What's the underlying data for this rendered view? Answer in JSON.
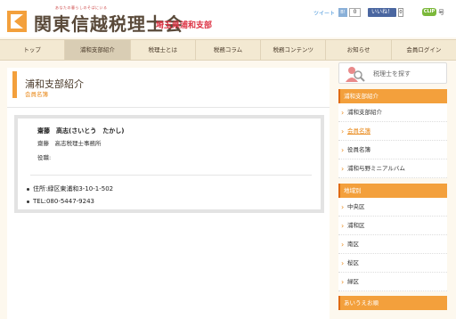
{
  "header": {
    "tagline": "あなたの暮らしのそばにいる",
    "brand": "関東信越税理士会",
    "branch": "埼玉県浦和支部",
    "tweet_label": "ツイート",
    "tw_badge": "B!",
    "tw_count": "0",
    "fb_label": "いいね！",
    "fb_count": "0",
    "clip_label": "CLIP",
    "clip_suffix": "号"
  },
  "nav": {
    "items": [
      "トップ",
      "浦和支部紹介",
      "税理士とは",
      "税務コラム",
      "税務コンテンツ",
      "お知らせ",
      "会員ログイン"
    ],
    "active_index": 1
  },
  "main": {
    "title": "浦和支部紹介",
    "subtitle": "会員名簿",
    "member": {
      "name": "齋藤　高志(さいとう　たかし)",
      "office": "齋藤　高志税理士事務所",
      "role": "役職:",
      "address": "住所:緑区東浦和3-10-1-502",
      "tel": "TEL:080-5447-9243"
    }
  },
  "sidebar": {
    "search_label": "税理士を探す",
    "section1": {
      "heading": "浦和支部紹介",
      "items": [
        "浦和支部紹介",
        "会員名簿",
        "役員名簿",
        "浦和与野ミニアルバム"
      ],
      "current_index": 1
    },
    "section2": {
      "heading": "地域別",
      "items": [
        "中央区",
        "浦和区",
        "南区",
        "桜区",
        "緑区"
      ]
    },
    "section3": {
      "heading": "あいうえお順"
    }
  },
  "colors": {
    "accent": "#f3a03c",
    "accent_text": "#e98a1c",
    "brand_red": "#d34"
  }
}
